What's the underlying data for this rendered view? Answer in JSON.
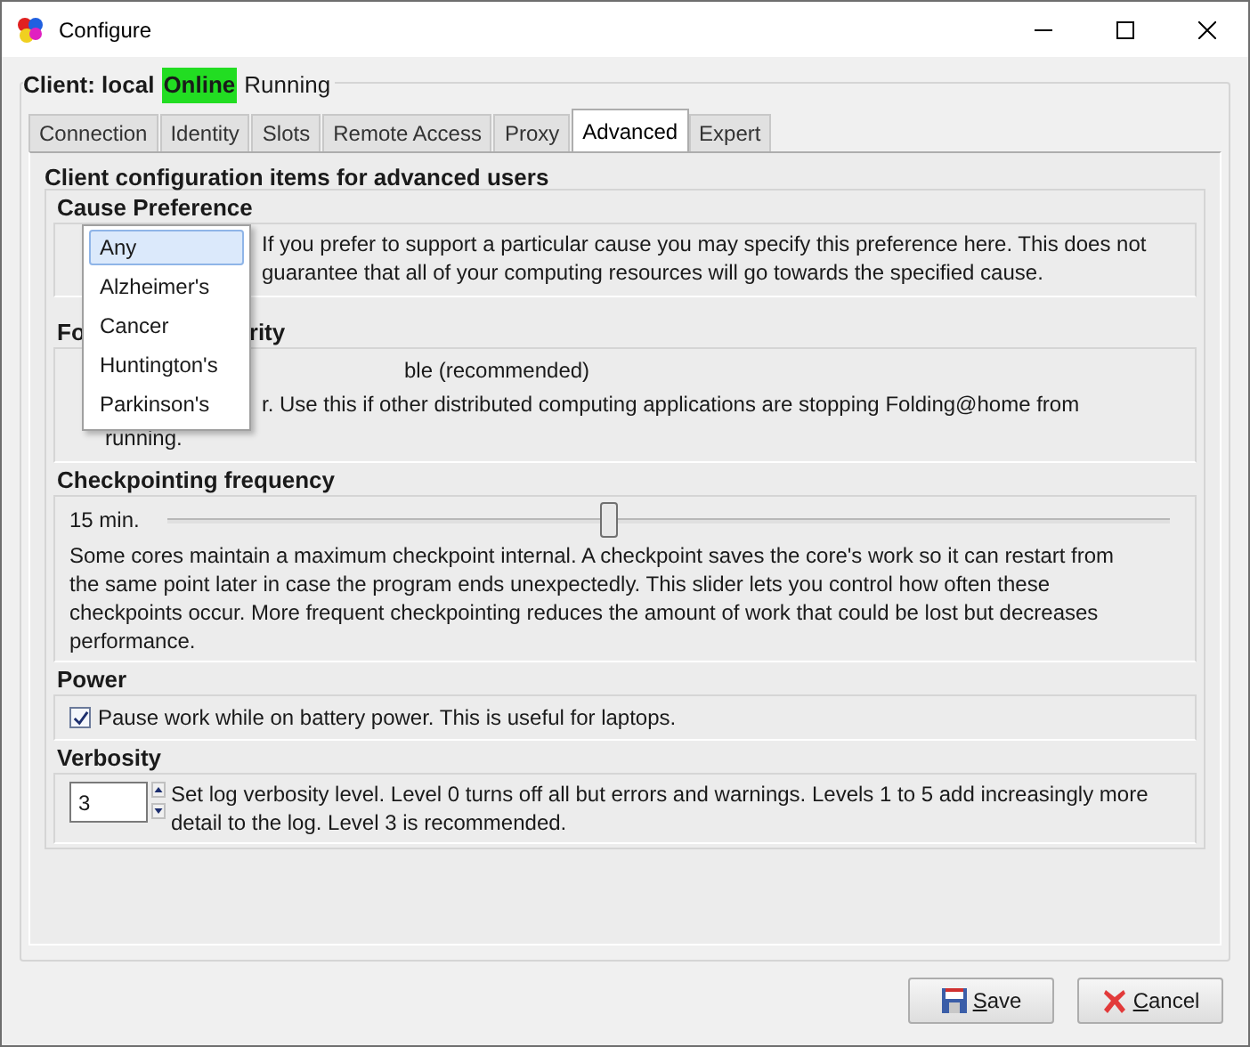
{
  "window": {
    "title": "Configure"
  },
  "client": {
    "label": "Client: local",
    "status": "Online",
    "state": "Running"
  },
  "tabs": [
    {
      "label": "Connection",
      "selected": false
    },
    {
      "label": "Identity",
      "selected": false
    },
    {
      "label": "Slots",
      "selected": false
    },
    {
      "label": "Remote Access",
      "selected": false
    },
    {
      "label": "Proxy",
      "selected": false
    },
    {
      "label": "Advanced",
      "selected": true
    },
    {
      "label": "Expert",
      "selected": false
    }
  ],
  "panel_title": "Client configuration items for advanced users",
  "sections": [
    {
      "kind": "cause",
      "title": "Cause Preference",
      "description": "If you prefer to support a particular cause you may specify this preference here.  This does not guarantee that all of your computing resources will go towards the specified cause."
    },
    {
      "kind": "priority",
      "title_parts": [
        "Fo",
        "rity"
      ],
      "lines": [
        "ble (recommended)",
        "r.  Use this if other distributed computing applications are stopping Folding@home from",
        "running."
      ]
    },
    {
      "kind": "slider",
      "title": "Checkpointing frequency",
      "reading": "15 min.",
      "level": 0.44,
      "description": "Some cores maintain a maximum checkpoint internal.  A checkpoint saves the core's work so it can restart from the same point later in case the program ends unexpectedly.  This slider lets you control how often these checkpoints occur.  More frequent checkpointing reduces the amount of work that could be lost but decreases performance."
    },
    {
      "kind": "checkbox",
      "title": "Power",
      "label": "Pause work while on battery power.  This is useful for laptops.",
      "checked": true
    },
    {
      "kind": "spinner",
      "title": "Verbosity",
      "value": "3",
      "description": "Set log verbosity level.  Level 0 turns off all but errors and warnings.  Levels 1 to 5 add increasingly more detail to the log.  Level 3 is recommended."
    }
  ],
  "dropdown": {
    "options": [
      {
        "label": "Any",
        "selected": true
      },
      {
        "label": "Alzheimer's",
        "selected": false
      },
      {
        "label": "Cancer",
        "selected": false
      },
      {
        "label": "Huntington's",
        "selected": false
      },
      {
        "label": "Parkinson's",
        "selected": false
      }
    ]
  },
  "buttons": [
    {
      "kind": "save",
      "label": "Save"
    },
    {
      "kind": "cancel",
      "label": "Cancel"
    }
  ]
}
